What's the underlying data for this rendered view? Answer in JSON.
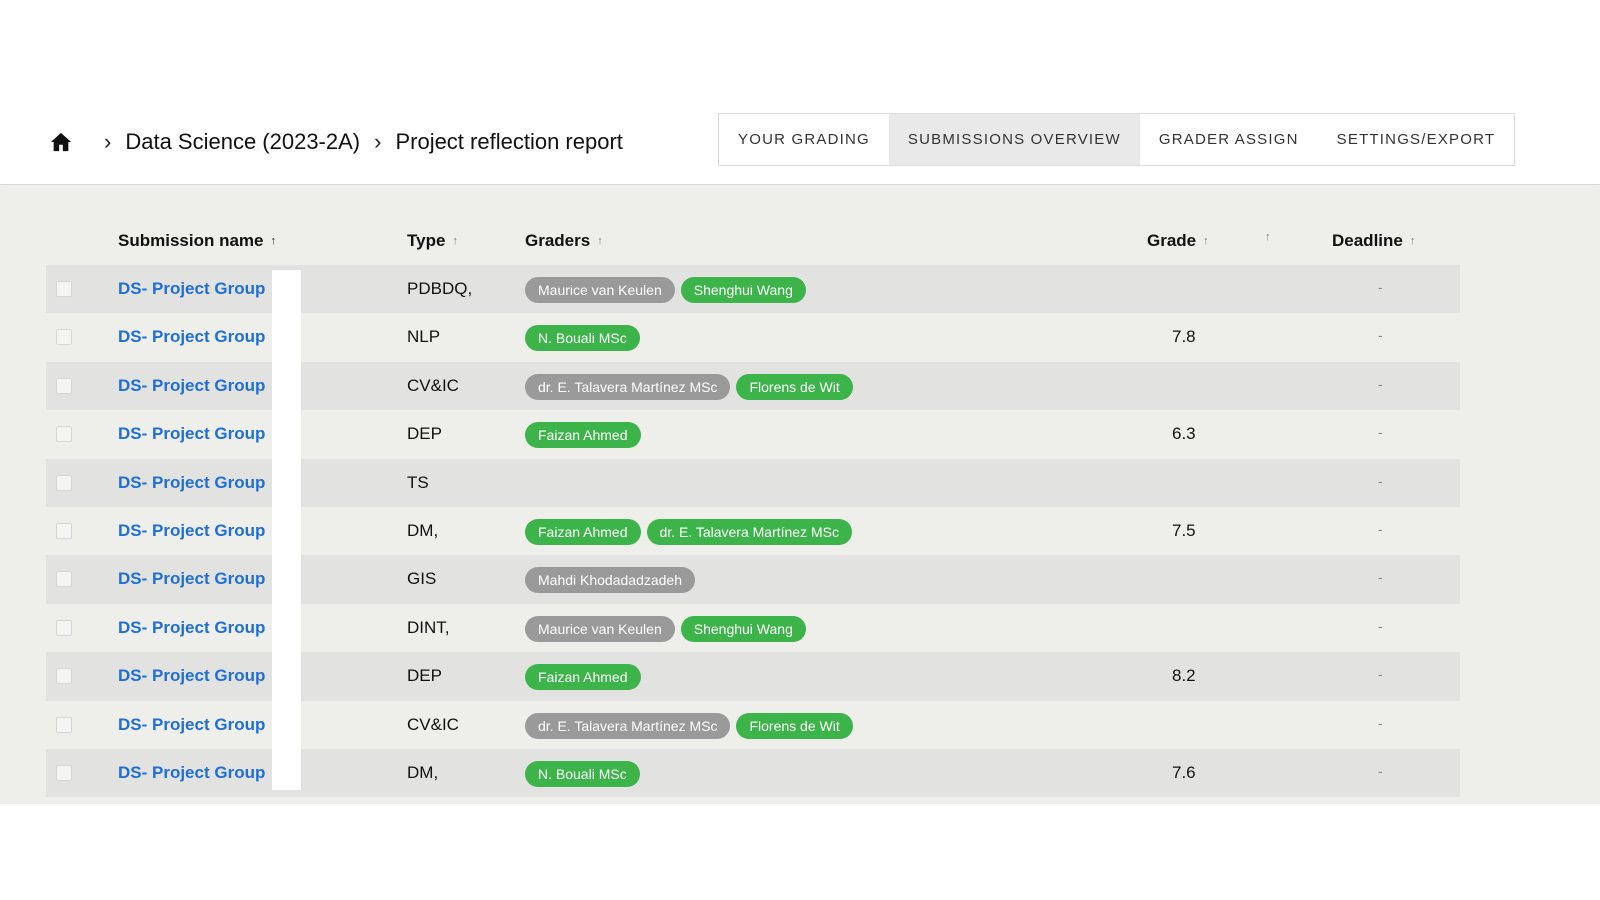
{
  "breadcrumb": {
    "home_icon": "home-icon",
    "course": "Data Science (2023-2A)",
    "assignment": "Project reflection report"
  },
  "tabs": [
    {
      "label": "YOUR GRADING",
      "active": false
    },
    {
      "label": "SUBMISSIONS OVERVIEW",
      "active": true
    },
    {
      "label": "GRADER ASSIGN",
      "active": false
    },
    {
      "label": "SETTINGS/EXPORT",
      "active": false
    }
  ],
  "columns": {
    "name": "Submission name",
    "type": "Type",
    "graders": "Graders",
    "grade": "Grade",
    "deadline": "Deadline"
  },
  "colors": {
    "link": "#1f6fd6",
    "grader_green": "#3cb44a",
    "grader_grey": "#9a9a9a"
  },
  "rows": [
    {
      "name": "DS- Project Group",
      "type": "PDBDQ,",
      "grade": "",
      "deadline": "-",
      "graders": [
        {
          "name": "Maurice van Keulen",
          "color": "grey"
        },
        {
          "name": "Shenghui Wang",
          "color": "green"
        }
      ]
    },
    {
      "name": "DS- Project Group",
      "type": "NLP",
      "grade": "7.8",
      "deadline": "-",
      "graders": [
        {
          "name": "N. Bouali MSc",
          "color": "green"
        }
      ]
    },
    {
      "name": "DS- Project Group",
      "type": "CV&IC",
      "grade": "",
      "deadline": "-",
      "graders": [
        {
          "name": "dr. E. Talavera Martínez MSc",
          "color": "grey"
        },
        {
          "name": "Florens de Wit",
          "color": "green"
        }
      ]
    },
    {
      "name": "DS- Project Group",
      "type": "DEP",
      "grade": "6.3",
      "deadline": "-",
      "graders": [
        {
          "name": "Faizan Ahmed",
          "color": "green"
        }
      ]
    },
    {
      "name": "DS- Project Group",
      "type": "TS",
      "grade": "",
      "deadline": "-",
      "graders": []
    },
    {
      "name": "DS- Project Group",
      "type": "DM,",
      "grade": "7.5",
      "deadline": "-",
      "graders": [
        {
          "name": "Faizan Ahmed",
          "color": "green"
        },
        {
          "name": "dr. E. Talavera Martínez MSc",
          "color": "green"
        }
      ]
    },
    {
      "name": "DS- Project Group",
      "type": "GIS",
      "grade": "",
      "deadline": "-",
      "graders": [
        {
          "name": "Mahdi Khodadadzadeh",
          "color": "grey"
        }
      ]
    },
    {
      "name": "DS- Project Group",
      "type": "DINT,",
      "grade": "",
      "deadline": "-",
      "graders": [
        {
          "name": "Maurice van Keulen",
          "color": "grey"
        },
        {
          "name": "Shenghui Wang",
          "color": "green"
        }
      ]
    },
    {
      "name": "DS- Project Group",
      "type": "DEP",
      "grade": "8.2",
      "deadline": "-",
      "graders": [
        {
          "name": "Faizan Ahmed",
          "color": "green"
        }
      ]
    },
    {
      "name": "DS- Project Group",
      "type": "CV&IC",
      "grade": "",
      "deadline": "-",
      "graders": [
        {
          "name": "dr. E. Talavera Martínez MSc",
          "color": "grey"
        },
        {
          "name": "Florens de Wit",
          "color": "green"
        }
      ]
    },
    {
      "name": "DS- Project Group",
      "type": "DM,",
      "grade": "7.6",
      "deadline": "-",
      "graders": [
        {
          "name": "N. Bouali MSc",
          "color": "green"
        }
      ]
    }
  ]
}
